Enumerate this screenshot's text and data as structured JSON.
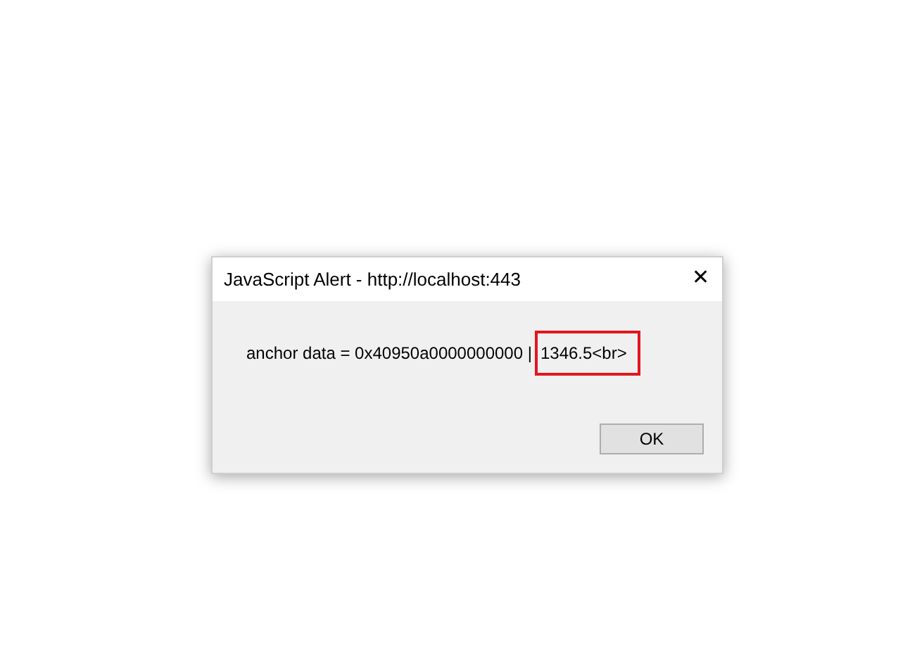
{
  "window": {
    "title": "JavaScript Alert - http://localhost:443",
    "close": "✕"
  },
  "message": [
    {
      "text": "anchor data = 0x40950a0000000000 |",
      "highlighted": false
    },
    {
      "text": "1346.5<br>",
      "highlighted": true
    }
  ],
  "buttons": [
    "OK"
  ]
}
